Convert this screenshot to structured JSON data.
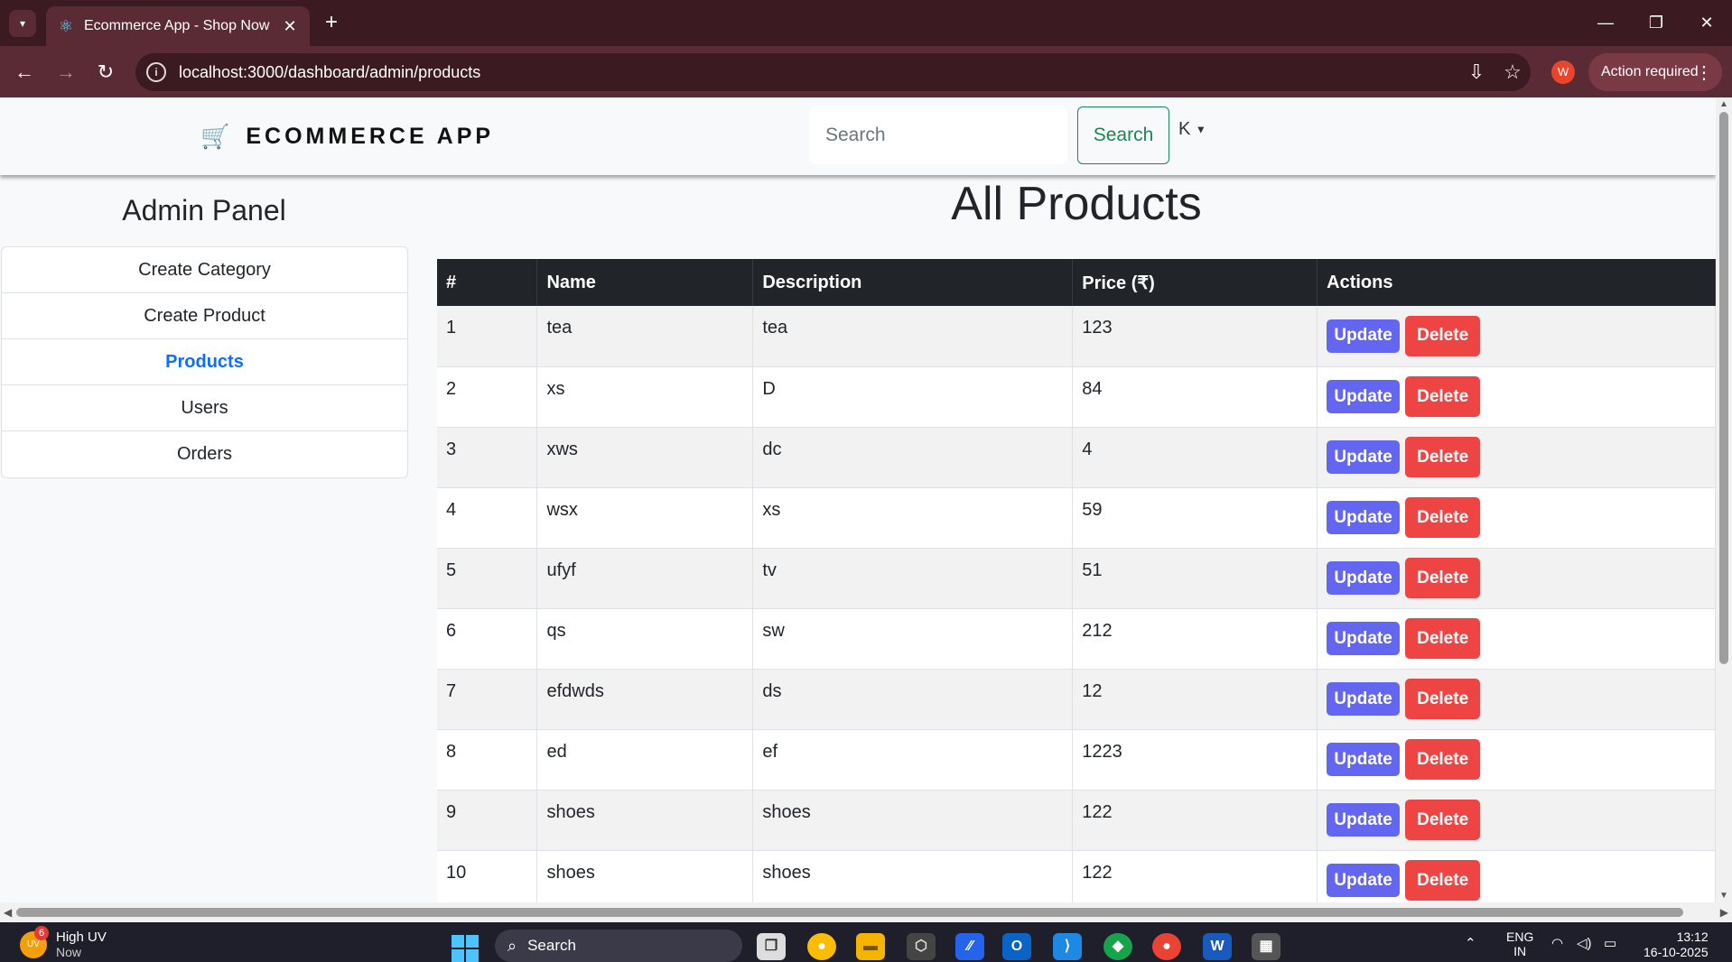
{
  "browser": {
    "tab_title": "Ecommerce App - Shop Now",
    "tab_close": "✕",
    "new_tab": "+",
    "url": "localhost:3000/dashboard/admin/products",
    "profile_initial": "W",
    "action_required": "Action required"
  },
  "header": {
    "brand": "ECOMMERCE APP",
    "search_placeholder": "Search",
    "search_button": "Search",
    "user_initial": "K"
  },
  "sidebar": {
    "title": "Admin Panel",
    "items": [
      {
        "label": "Create Category"
      },
      {
        "label": "Create Product"
      },
      {
        "label": "Products",
        "active": true
      },
      {
        "label": "Users"
      },
      {
        "label": "Orders"
      }
    ]
  },
  "main": {
    "title": "All Products",
    "columns": [
      "#",
      "Name",
      "Description",
      "Price (₹)",
      "Actions"
    ],
    "update_label": "Update",
    "delete_label": "Delete",
    "rows": [
      {
        "id": "1",
        "name": "tea",
        "description": "tea",
        "price": "123"
      },
      {
        "id": "2",
        "name": "xs",
        "description": "D",
        "price": "84"
      },
      {
        "id": "3",
        "name": "xws",
        "description": "dc",
        "price": "4"
      },
      {
        "id": "4",
        "name": "wsx",
        "description": "xs",
        "price": "59"
      },
      {
        "id": "5",
        "name": "ufyf",
        "description": "tv",
        "price": "51"
      },
      {
        "id": "6",
        "name": "qs",
        "description": "sw",
        "price": "212"
      },
      {
        "id": "7",
        "name": "efdwds",
        "description": "ds",
        "price": "12"
      },
      {
        "id": "8",
        "name": "ed",
        "description": "ef",
        "price": "1223"
      },
      {
        "id": "9",
        "name": "shoes",
        "description": "shoes",
        "price": "122"
      },
      {
        "id": "10",
        "name": "shoes",
        "description": "shoes",
        "price": "122"
      }
    ]
  },
  "taskbar": {
    "weather_title": "High UV",
    "weather_sub": "Now",
    "weather_badge": "6",
    "weather_icon_text": "UV",
    "search": "Search",
    "lang_top": "ENG",
    "lang_bottom": "IN",
    "time": "13:12",
    "date": "16-10-2025"
  },
  "colors": {
    "update": "#6366f1",
    "delete": "#ef4444",
    "active_link": "#0d6efd",
    "search_button": "#198754",
    "chrome": "#3c1a21"
  }
}
